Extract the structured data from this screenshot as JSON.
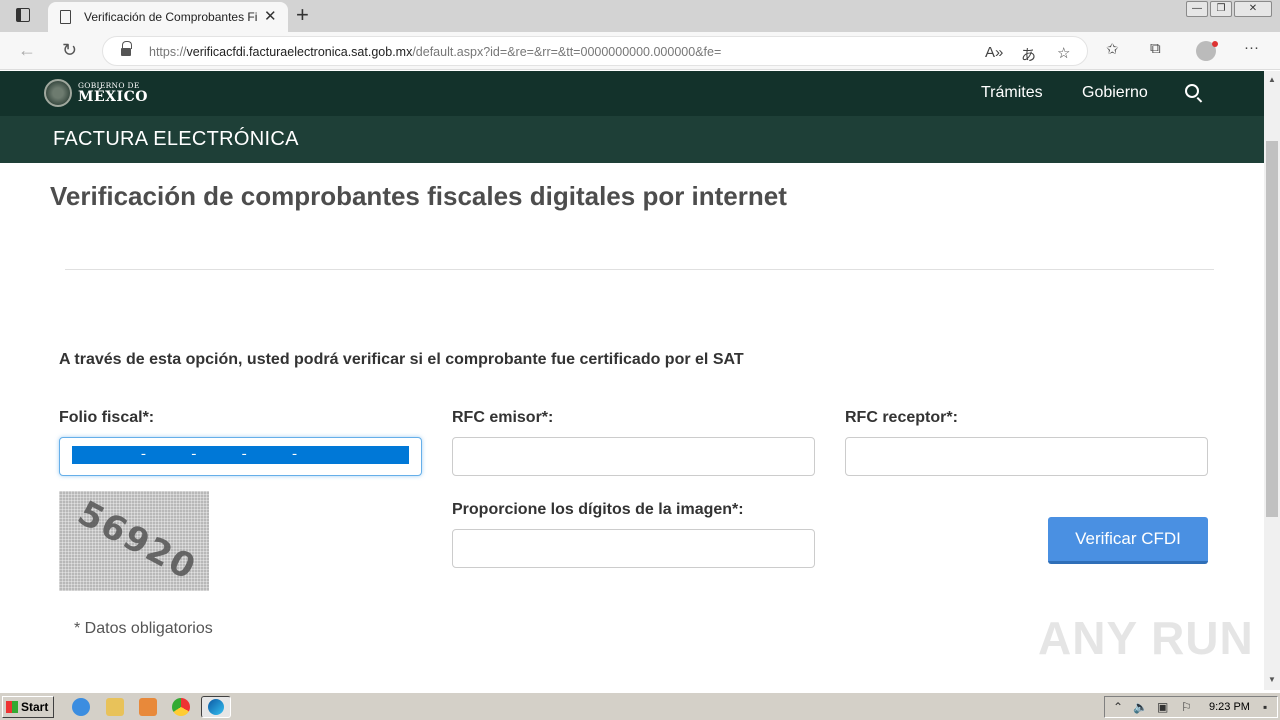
{
  "browser": {
    "tab_title": "Verificación de Comprobantes Fi",
    "url_prefix": "https://",
    "url_host": "verificacfdi.facturaelectronica.sat.gob.mx",
    "url_rest": "/default.aspx?id=&re=&rr=&tt=0000000000.000000&fe="
  },
  "header": {
    "logo_small": "GOBIERNO DE",
    "logo_big": "MÉXICO",
    "nav": [
      "Trámites",
      "Gobierno"
    ],
    "section_title": "FACTURA ELECTRÓNICA"
  },
  "main": {
    "title": "Verificación de comprobantes fiscales digitales por internet",
    "intro": "A través de esta opción, usted podrá verificar si el comprobante fue certificado por el SAT",
    "folio_label": "Folio fiscal*:",
    "folio_value": "        -     -     -     -            ",
    "rfc_emisor_label": "RFC emisor*:",
    "rfc_receptor_label": "RFC receptor*:",
    "captcha_label": "Proporcione los dígitos de la imagen*:",
    "captcha_text": "56920",
    "verify_button": "Verificar CFDI",
    "required_note": "* Datos obligatorios"
  },
  "watermark": "ANY RUN",
  "taskbar": {
    "start_label": "Start",
    "clock": "9:23 PM"
  },
  "colors": {
    "header_bg": "#13322b",
    "section_bg": "#1e3f37",
    "button_bg": "#4a90e2"
  }
}
